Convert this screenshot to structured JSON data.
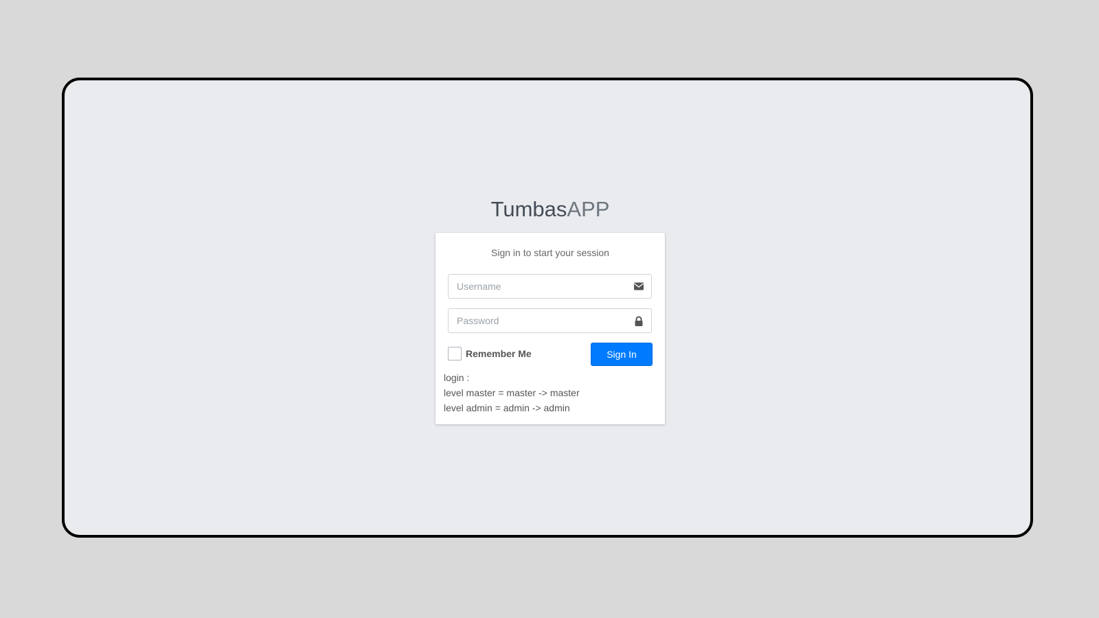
{
  "logo": {
    "bold": "Tumbas",
    "light": "APP"
  },
  "card": {
    "message": "Sign in to start your session",
    "username": {
      "placeholder": "Username",
      "value": "",
      "icon": "envelope-icon"
    },
    "password": {
      "placeholder": "Password",
      "value": "",
      "icon": "lock-icon"
    },
    "remember_label": "Remember Me",
    "remember_checked": false,
    "signin_label": "Sign In",
    "info_lines": [
      "login :",
      "level master = master -> master",
      "level admin = admin -> admin"
    ]
  },
  "colors": {
    "primary": "#007bff",
    "background": "#e9ebee",
    "outer": "#d9d9d9"
  }
}
